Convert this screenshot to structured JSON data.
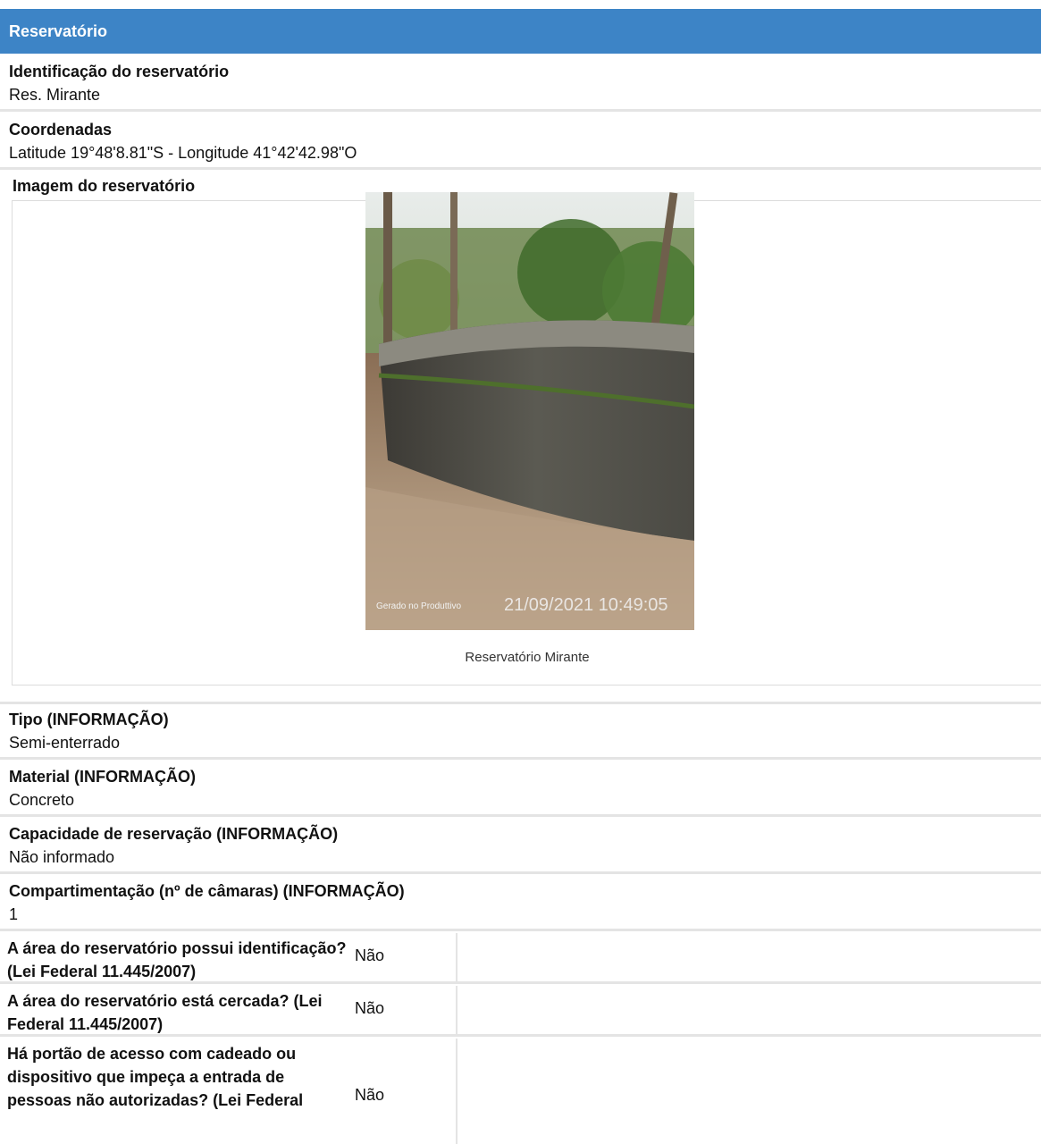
{
  "section": {
    "title": "Reservatório"
  },
  "identificacao": {
    "label": "Identificação do reservatório",
    "value": "Res. Mirante"
  },
  "coordenadas": {
    "label": "Coordenadas",
    "value": "Latitude 19°48'8.81\"S - Longitude 41°42'42.98\"O"
  },
  "imagem": {
    "label": "Imagem do reservatório",
    "caption": "Reservatório Mirante",
    "watermark_left": "Gerado no Produttivo",
    "watermark_timestamp": "21/09/2021 10:49:05"
  },
  "fields": [
    {
      "label": "Tipo (INFORMAÇÃO)",
      "value": "Semi-enterrado"
    },
    {
      "label": "Material (INFORMAÇÃO)",
      "value": "Concreto"
    },
    {
      "label": "Capacidade de reservação (INFORMAÇÃO)",
      "value": "Não informado"
    },
    {
      "label": "Compartimentação (nº de câmaras) (INFORMAÇÃO)",
      "value": "1"
    }
  ],
  "questions": [
    {
      "label": "A área do reservatório possui identificação? (Lei Federal 11.445/2007)",
      "answer": "Não"
    },
    {
      "label": "A área do reservatório está cercada? (Lei Federal 11.445/2007)",
      "answer": "Não"
    },
    {
      "label": "Há portão de acesso com cadeado ou dispositivo que impeça a entrada de pessoas não autorizadas? (Lei Federal",
      "answer": "Não"
    }
  ]
}
